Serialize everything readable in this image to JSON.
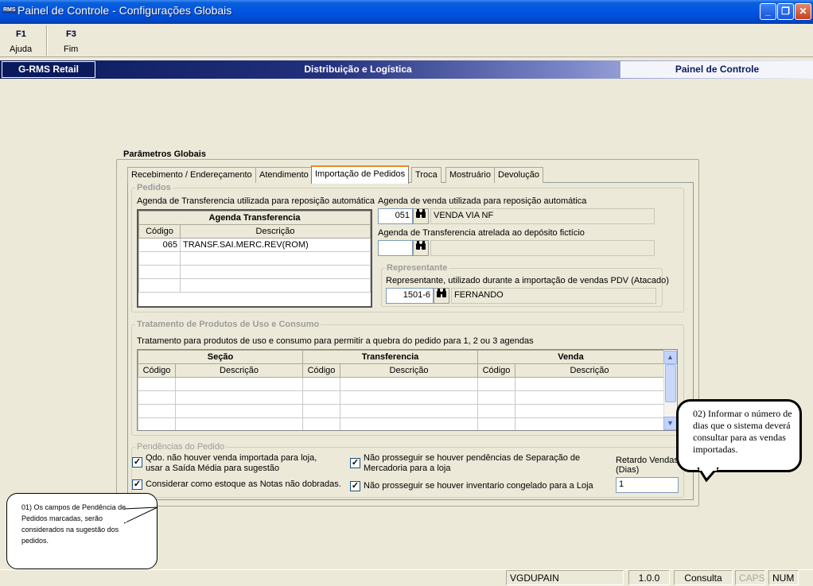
{
  "window": {
    "app_logo": "RMS",
    "title": "Painel de Controle - Configurações Globais",
    "minimize": "_",
    "restore": "❐",
    "close": "✕"
  },
  "toolbar": {
    "items": [
      {
        "key": "F1",
        "label": "Ajuda"
      },
      {
        "key": "F3",
        "label": "Fim"
      }
    ]
  },
  "header": {
    "left": "G-RMS Retail",
    "center": "Distribuição e Logística",
    "right": "Painel de Controle"
  },
  "params": {
    "title": "Parâmetros Globais",
    "tabs": [
      "Recebimento / Endereçamento",
      "Atendimento",
      "Importação de Pedidos",
      "Troca",
      "Mostruário",
      "Devolução"
    ],
    "active_tab": "Importação de Pedidos"
  },
  "pedidos": {
    "group_title": "Pedidos",
    "transfer_label": "Agenda de Transferencia utilizada para reposição automática",
    "grid": {
      "title": "Agenda Transferencia",
      "columns": [
        "Código",
        "Descrição"
      ],
      "rows": [
        {
          "codigo": "065",
          "descricao": "TRANSF.SAI.MERC.REV(ROM)"
        }
      ]
    },
    "venda_label": "Agenda de venda utilizada para reposição automática",
    "venda_codigo": "051",
    "venda_descricao": "VENDA VIA NF",
    "ficticio_label": "Agenda de Transferencia atrelada ao depósito fictício",
    "ficticio_codigo": "",
    "ficticio_descricao": ""
  },
  "representante": {
    "group_title": "Representante",
    "label": "Representante, utilizado durante a importação de vendas PDV (Atacado)",
    "codigo": "1501-6",
    "nome": "FERNANDO"
  },
  "tratamento": {
    "group_title": "Tratamento de Produtos de Uso e Consumo",
    "label": "Tratamento para produtos de uso e consumo para permitir a quebra do pedido para 1, 2 ou 3 agendas",
    "groups": [
      "Seção",
      "Transferencia",
      "Venda"
    ],
    "columns": [
      "Código",
      "Descrição",
      "Código",
      "Descrição",
      "Código",
      "Descrição"
    ]
  },
  "pendencias": {
    "group_title": "Pendências do Pedido",
    "chk_saida_media": "Qdo. não houver venda importada para loja, usar a Saída Média para sugestão",
    "chk_notas": "Considerar como estoque as Notas não dobradas.",
    "chk_separacao": "Não prosseguir se houver pendências de Separação de Mercadoria para a loja",
    "chk_inventario": "Não prosseguir se houver inventario congelado para a Loja",
    "check_mark": "✓",
    "retardo_label": "Retardo Vendas (Dias)",
    "retardo_value": "1"
  },
  "callouts": {
    "c1": "01) Os campos de Pendência de Pedidos marcadas, serão considerados na sugestão dos pedidos.",
    "c2": "02) Informar o número de dias que o sistema deverá consultar para as vendas importadas."
  },
  "status": {
    "user": "VGDUPAIN",
    "version": "1.0.0",
    "mode": "Consulta",
    "caps": "CAPS",
    "num": "NUM"
  },
  "icons": {
    "binoculars": "binoculars-icon",
    "scroll_up": "▲",
    "scroll_down": "▼"
  }
}
